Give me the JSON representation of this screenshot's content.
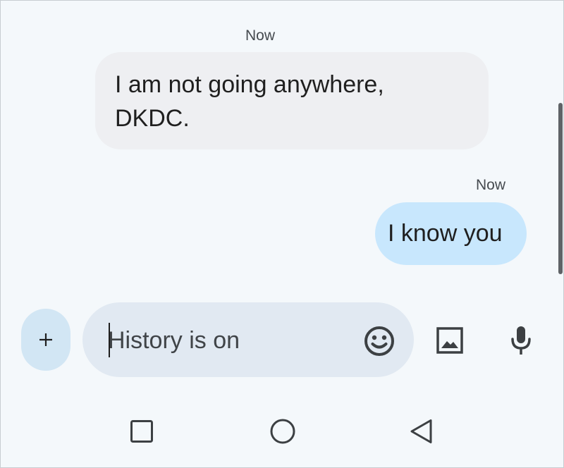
{
  "conversation": {
    "messages": [
      {
        "direction": "received",
        "timestamp": "Now",
        "text_lines": [
          "I am not going anywhere,",
          "DKDC."
        ]
      },
      {
        "direction": "sent",
        "timestamp": "Now",
        "text": "I know you"
      }
    ]
  },
  "composer": {
    "attach_icon": "plus-icon",
    "placeholder": "History is on",
    "value": "",
    "emoji_icon": "emoji-icon",
    "gallery_icon": "image-icon",
    "voice_icon": "mic-icon"
  },
  "navigation_bar": {
    "buttons": [
      "recents-icon",
      "home-icon",
      "back-icon"
    ]
  },
  "colors": {
    "background": "#f4f8fb",
    "received_bubble": "#eeeff2",
    "sent_bubble": "#c8e7fd",
    "compose_field": "#e1e9f2",
    "plus_button": "#d2e6f4",
    "icon": "#3c4043"
  }
}
